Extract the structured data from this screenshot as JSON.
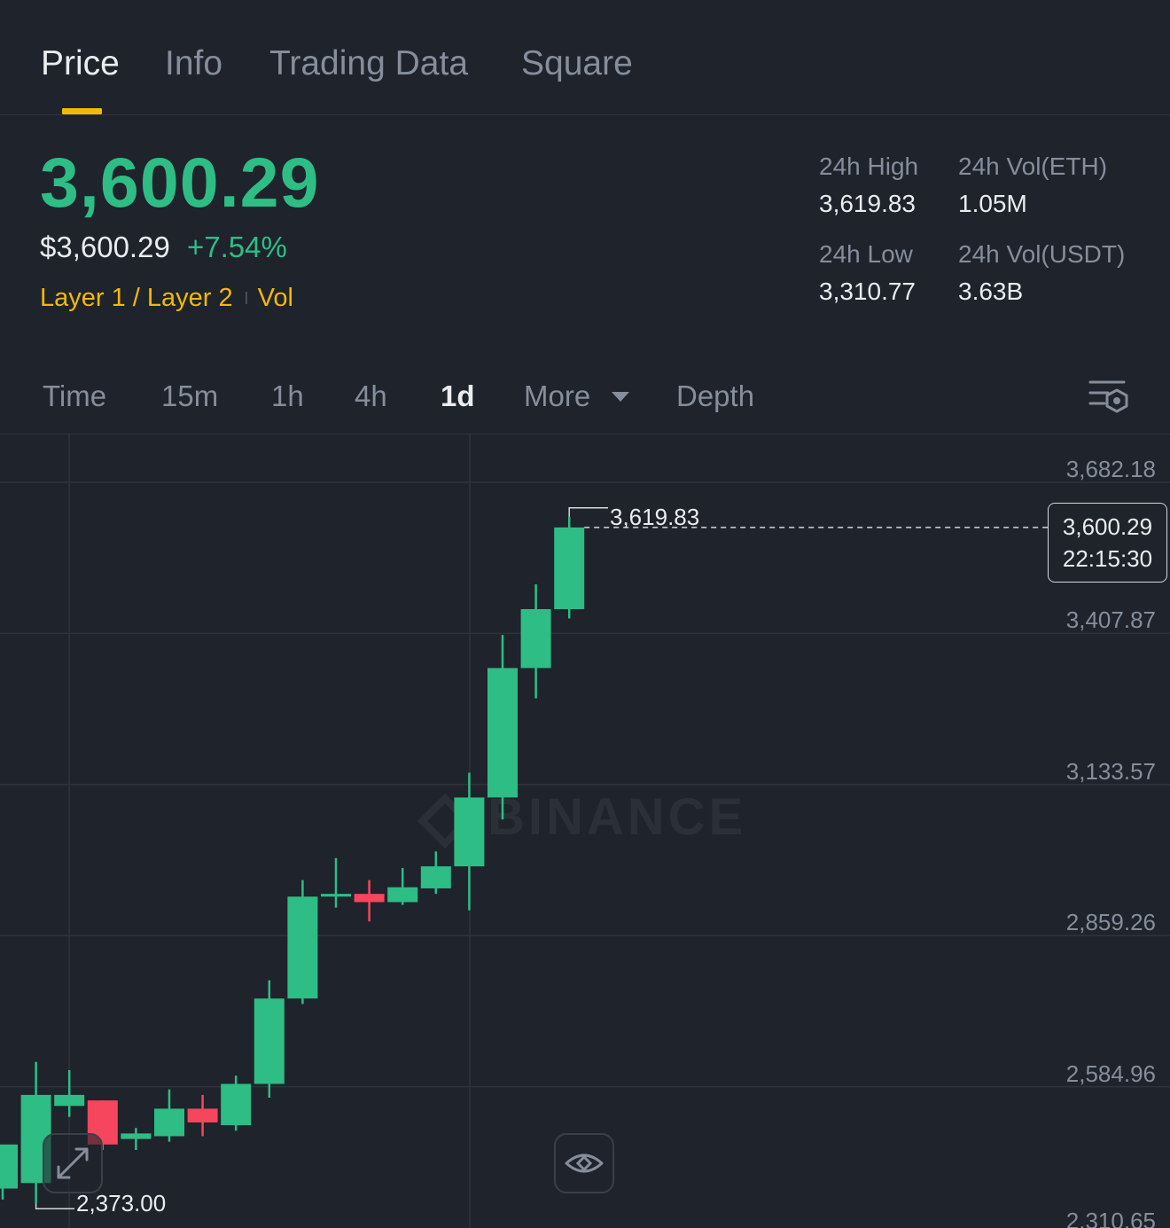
{
  "tabs": [
    {
      "label": "Price",
      "active": true
    },
    {
      "label": "Info",
      "active": false
    },
    {
      "label": "Trading Data",
      "active": false
    },
    {
      "label": "Square",
      "active": false
    }
  ],
  "ticker": {
    "price": "3,600.29",
    "usd_price": "$3,600.29",
    "change_pct": "+7.54%",
    "tag_category": "Layer 1 / Layer 2",
    "tag_vol": "Vol",
    "stats": {
      "high_label": "24h High",
      "high_value": "3,619.83",
      "low_label": "24h Low",
      "low_value": "3,310.77",
      "vol_eth_label": "24h Vol(ETH)",
      "vol_eth_value": "1.05M",
      "vol_usdt_label": "24h Vol(USDT)",
      "vol_usdt_value": "3.63B"
    }
  },
  "intervals": {
    "items": [
      "Time",
      "15m",
      "1h",
      "4h",
      "1d"
    ],
    "active": "1d",
    "more_label": "More",
    "depth_label": "Depth"
  },
  "colors": {
    "up": "#2ebd85",
    "down": "#f6465d",
    "accent": "#f0b90b",
    "background": "#1f232b"
  },
  "chart_data": {
    "type": "candlestick",
    "watermark": "BINANCE",
    "y_ticks": [
      "3,682.18",
      "3,407.87",
      "3,133.57",
      "2,859.26",
      "2,584.96",
      "2,310.65"
    ],
    "ylim": [
      2310.65,
      3682.18
    ],
    "last_price": "3,600.29",
    "countdown": "22:15:30",
    "high_marker": "3,619.83",
    "low_marker": "2,373.00",
    "candles": [
      {
        "o": 2400,
        "h": 2420,
        "c": 2480,
        "l": 2380
      },
      {
        "o": 2410,
        "h": 2630,
        "c": 2570,
        "l": 2373
      },
      {
        "o": 2550,
        "h": 2615,
        "c": 2570,
        "l": 2530
      },
      {
        "o": 2560,
        "h": 2560,
        "c": 2480,
        "l": 2470
      },
      {
        "o": 2490,
        "h": 2510,
        "c": 2500,
        "l": 2470
      },
      {
        "o": 2495,
        "h": 2580,
        "c": 2545,
        "l": 2485
      },
      {
        "o": 2545,
        "h": 2570,
        "c": 2520,
        "l": 2495
      },
      {
        "o": 2515,
        "h": 2605,
        "c": 2590,
        "l": 2505
      },
      {
        "o": 2590,
        "h": 2778,
        "c": 2745,
        "l": 2565
      },
      {
        "o": 2745,
        "h": 2960,
        "c": 2930,
        "l": 2735
      },
      {
        "o": 2930,
        "h": 3000,
        "c": 2935,
        "l": 2910
      },
      {
        "o": 2935,
        "h": 2960,
        "c": 2920,
        "l": 2885
      },
      {
        "o": 2920,
        "h": 2982,
        "c": 2947,
        "l": 2915
      },
      {
        "o": 2945,
        "h": 3012,
        "c": 2985,
        "l": 2935
      },
      {
        "o": 2985,
        "h": 3155,
        "c": 3110,
        "l": 2905
      },
      {
        "o": 3110,
        "h": 3405,
        "c": 3345,
        "l": 3070
      },
      {
        "o": 3345,
        "h": 3497,
        "c": 3452,
        "l": 3290
      },
      {
        "o": 3452,
        "h": 3619.83,
        "c": 3600.29,
        "l": 3435
      }
    ]
  }
}
